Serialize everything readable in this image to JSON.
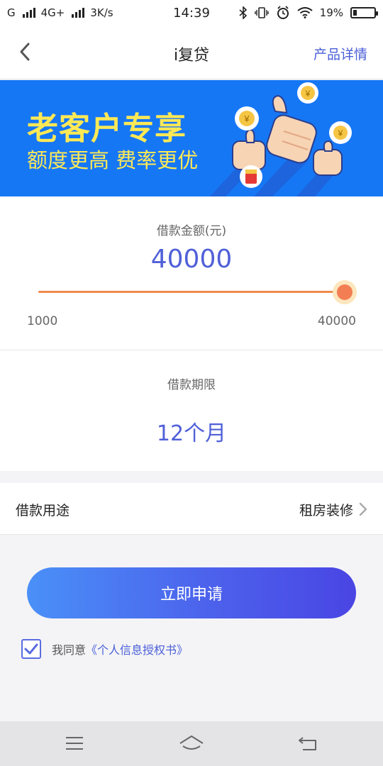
{
  "status_bar": {
    "carrier1": "G",
    "carrier2": "4G+",
    "speed": "3K/s",
    "time": "14:39",
    "battery": "19%",
    "battery_level": 0.19,
    "icons": [
      "signal-icon",
      "signal-icon",
      "bluetooth-icon",
      "vibrate-icon",
      "alarm-icon",
      "wifi-icon",
      "battery-icon"
    ]
  },
  "nav": {
    "title": "i复贷",
    "link": "产品详情",
    "back_icon": "chevron-left-icon"
  },
  "banner": {
    "line1": "老客户专享",
    "line2": "额度更高 费率更优",
    "coin_symbol": "¥",
    "bg_color": "#1677f5",
    "text_color": "#ffe955"
  },
  "amount": {
    "label": "借款金额(元)",
    "value": "40000",
    "min": "1000",
    "max": "40000",
    "slider_fraction": 1.0
  },
  "term": {
    "label": "借款期限",
    "value": "12个月"
  },
  "purpose": {
    "label": "借款用途",
    "value": "租房装修"
  },
  "apply": {
    "label": "立即申请"
  },
  "agreement": {
    "prefix": "我同意",
    "link": "《个人信息授权书》",
    "checked": true
  },
  "system_nav": {
    "buttons": [
      "menu-icon",
      "home-icon",
      "back-icon"
    ]
  },
  "colors": {
    "accent": "#5060d8",
    "slider": "#f08a4a",
    "link": "#4a5fd8"
  }
}
